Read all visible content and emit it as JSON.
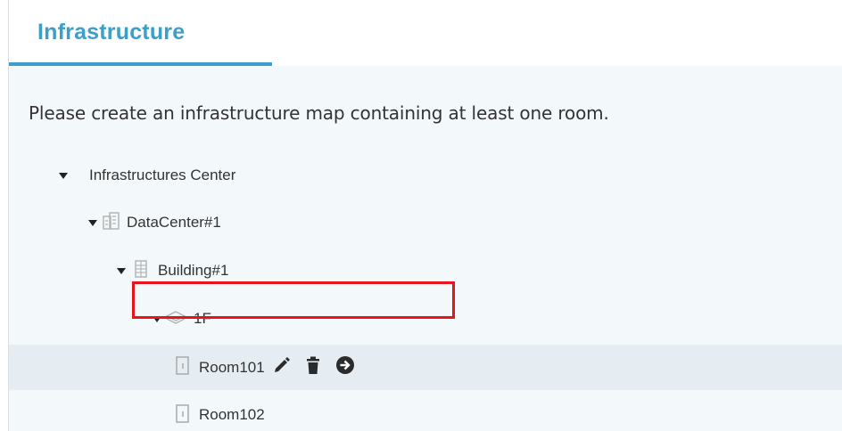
{
  "header": {
    "title": "Infrastructure"
  },
  "panel": {
    "hint": "Please create an infrastructure map containing at least one room."
  },
  "tree": {
    "root": {
      "label": "Infrastructures Center",
      "icon": "caret-down-icon"
    },
    "datacenter": {
      "label": "DataCenter#1",
      "icon": "datacenter-icon"
    },
    "building": {
      "label": "Building#1",
      "icon": "building-icon"
    },
    "floor": {
      "label": "1F",
      "icon": "layers-icon"
    },
    "rooms": [
      {
        "label": "Room101",
        "icon": "room-door-icon",
        "selected": true,
        "actions": [
          "edit-pencil-icon",
          "delete-trash-icon",
          "go-arrow-icon"
        ]
      },
      {
        "label": "Room102",
        "icon": "room-door-icon",
        "selected": false
      }
    ]
  },
  "colors": {
    "accent": "#3a9fc9",
    "highlight": "#e8131b",
    "panel_bg": "#f3f8fb",
    "selected_bg": "#e6edf2",
    "icon_gray": "#b5b5b5",
    "action_dark": "#2b2b2b"
  }
}
